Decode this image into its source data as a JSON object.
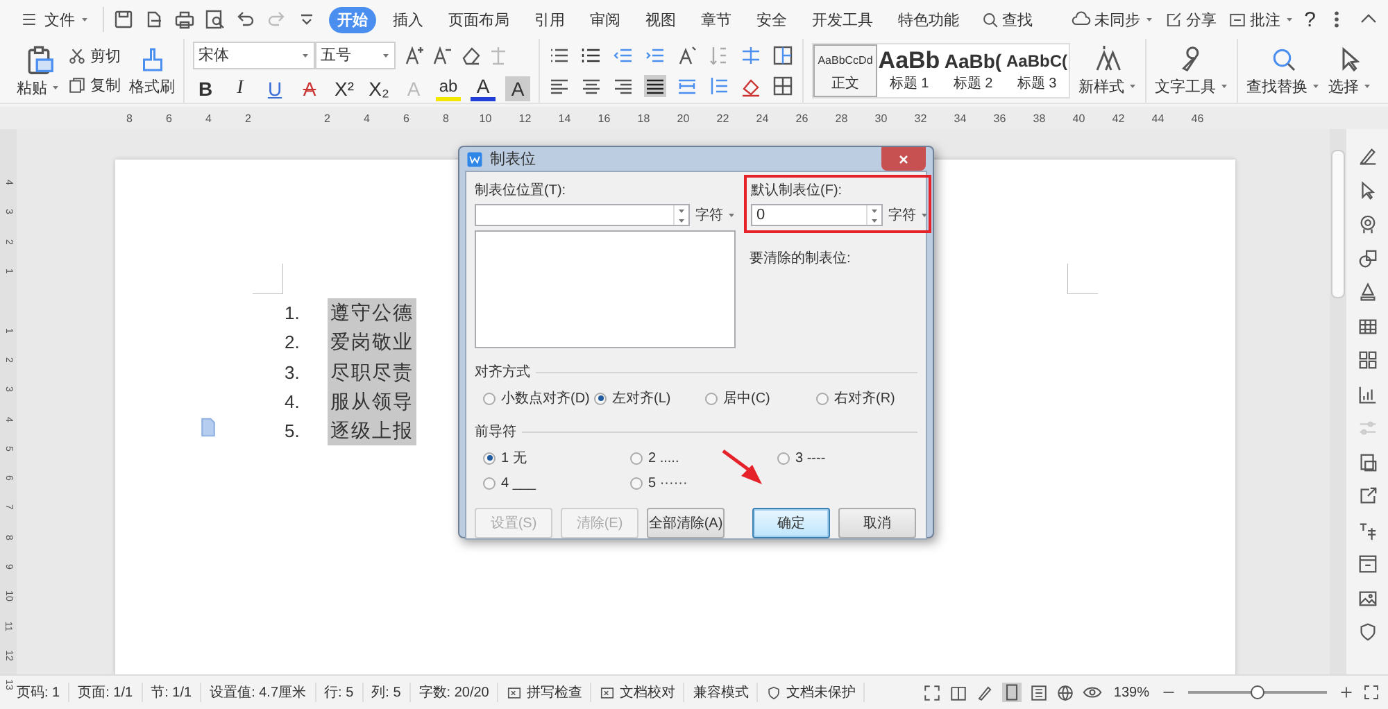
{
  "menu_bar": {
    "file": "文件",
    "tabs": [
      {
        "label": "开始",
        "selected": true
      },
      {
        "label": "插入",
        "selected": false
      },
      {
        "label": "页面布局",
        "selected": false
      },
      {
        "label": "引用",
        "selected": false
      },
      {
        "label": "审阅",
        "selected": false
      },
      {
        "label": "视图",
        "selected": false
      },
      {
        "label": "章节",
        "selected": false
      },
      {
        "label": "安全",
        "selected": false
      },
      {
        "label": "开发工具",
        "selected": false
      },
      {
        "label": "特色功能",
        "selected": false
      }
    ],
    "search": "查找",
    "sync": "未同步",
    "share": "分享",
    "comment": "批注",
    "help": "?"
  },
  "ribbon": {
    "paste": "粘贴",
    "cut": "剪切",
    "copy": "复制",
    "format_painter": "格式刷",
    "font": "宋体",
    "size": "五号",
    "format_buttons": [
      {
        "glyph": "B",
        "kind": "bold"
      },
      {
        "glyph": "I",
        "kind": "italic"
      },
      {
        "glyph": "U",
        "kind": "underline"
      },
      {
        "glyph": "A",
        "kind": "strike"
      },
      {
        "glyph": "X²",
        "kind": "plain"
      },
      {
        "glyph": "X₂",
        "kind": "plain"
      },
      {
        "glyph": "A",
        "kind": "outline"
      },
      {
        "glyph": "ab",
        "kind": "highlight"
      },
      {
        "glyph": "A",
        "kind": "color"
      },
      {
        "glyph": "A",
        "kind": "shaded"
      }
    ],
    "styles": [
      {
        "preview": "AaBbCcDd",
        "name": "正文",
        "kind": "body",
        "selected": true
      },
      {
        "preview": "AaBb",
        "name": "标题 1",
        "kind": "h1",
        "selected": false
      },
      {
        "preview": "AaBb(",
        "name": "标题 2",
        "kind": "h2",
        "selected": false
      },
      {
        "preview": "AaBbC(",
        "name": "标题 3",
        "kind": "h3",
        "selected": false
      }
    ],
    "new_style": "新样式",
    "text_tools": "文字工具",
    "find_replace": "查找替换",
    "select": "选择"
  },
  "ruler": {
    "left_labels": [
      "8",
      "6",
      "4",
      "2"
    ],
    "right_labels": [
      "2",
      "4",
      "6",
      "8",
      "10",
      "12",
      "14",
      "16",
      "18",
      "20",
      "22",
      "24",
      "26",
      "28",
      "30",
      "32",
      "34",
      "36",
      "38",
      "40",
      "42",
      "44",
      "46"
    ],
    "side_top_labels": [
      "4",
      "3",
      "2",
      "1"
    ],
    "side_labels": [
      "1",
      "2",
      "3",
      "4",
      "5",
      "6",
      "7",
      "8",
      "9",
      "10",
      "11",
      "12",
      "13"
    ]
  },
  "document": {
    "list": [
      {
        "number": "1.",
        "text": "遵守公德"
      },
      {
        "number": "2.",
        "text": "爱岗敬业"
      },
      {
        "number": "3.",
        "text": "尽职尽责"
      },
      {
        "number": "4.",
        "text": "服从领导"
      },
      {
        "number": "5.",
        "text": "逐级上报"
      }
    ]
  },
  "dialog": {
    "title": "制表位",
    "tab_position": {
      "label": "制表位位置(T):",
      "unit": "字符"
    },
    "default_tab": {
      "label": "默认制表位(F):",
      "value": "0",
      "unit": "字符"
    },
    "clear_label": "要清除的制表位:",
    "alignment": {
      "legend": "对齐方式",
      "options": [
        {
          "label": "小数点对齐(D)",
          "selected": false
        },
        {
          "label": "左对齐(L)",
          "selected": true
        },
        {
          "label": "居中(C)",
          "selected": false
        },
        {
          "label": "右对齐(R)",
          "selected": false
        }
      ]
    },
    "leader": {
      "legend": "前导符",
      "options": [
        {
          "label": "1 无",
          "selected": true
        },
        {
          "label": "2 .....",
          "selected": false
        },
        {
          "label": "3 ----",
          "selected": false
        },
        {
          "label": "4 ___",
          "selected": false
        },
        {
          "label": "5 ······",
          "selected": false
        }
      ]
    },
    "buttons": [
      {
        "label": "设置(S)",
        "disabled": true,
        "focused": false
      },
      {
        "label": "清除(E)",
        "disabled": true,
        "focused": false
      },
      {
        "label": "全部清除(A)",
        "disabled": false,
        "focused": false
      },
      {
        "label": "确定",
        "disabled": false,
        "focused": true
      },
      {
        "label": "取消",
        "disabled": false,
        "focused": false
      }
    ]
  },
  "status_bar": {
    "items": [
      {
        "label": "页码: 1",
        "kind": "text"
      },
      {
        "label": "页面: 1/1",
        "kind": "text"
      },
      {
        "label": "节: 1/1",
        "kind": "text"
      },
      {
        "label": "设置值: 4.7厘米",
        "kind": "text"
      },
      {
        "label": "行: 5",
        "kind": "text"
      },
      {
        "label": "列: 5",
        "kind": "text"
      },
      {
        "label": "字数: 20/20",
        "kind": "text"
      },
      {
        "label": "拼写检查",
        "kind": "check"
      },
      {
        "label": "文档校对",
        "kind": "check"
      },
      {
        "label": "兼容模式",
        "kind": "text"
      },
      {
        "label": "文档未保护",
        "kind": "shield"
      }
    ],
    "zoom": "139%",
    "zoom_slider": {
      "level": 0.5
    }
  }
}
